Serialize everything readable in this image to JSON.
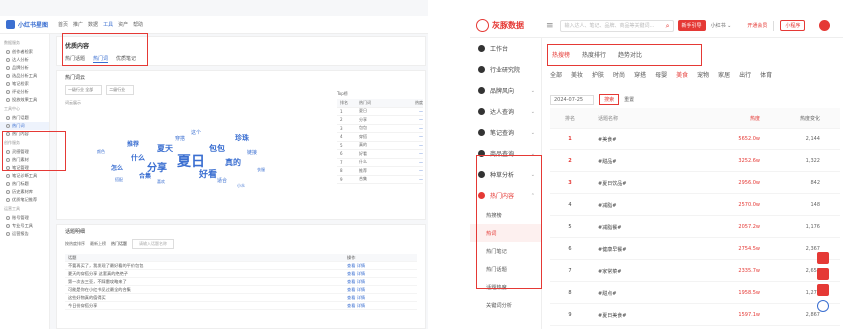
{
  "left": {
    "logo": "小红书星图",
    "nav": [
      "首页",
      "推广",
      "数据",
      "工具",
      "资产",
      "帮助"
    ],
    "sidebar": {
      "sections": [
        {
          "title": "数据服务",
          "items": [
            "创作者检索",
            "达人分析",
            "品牌分析",
            "选品分析工具",
            "笔记检索",
            "评论分析",
            "投放效果工具"
          ]
        },
        {
          "title": "工具中心",
          "items": [
            "热门话题",
            "热门词",
            "热门内容"
          ]
        },
        {
          "title": "创作服务",
          "items": [
            "灵感管理",
            "热门素材",
            "笔记管理",
            "笔记诊断工具",
            "热门标题",
            "历史素材库",
            "优质笔记推荐"
          ]
        },
        {
          "title": "运营工具",
          "items": [
            "账号管理",
            "专业号工具",
            "运营报告"
          ]
        }
      ],
      "active_item": "热门词"
    },
    "page_title": "优质内容",
    "tabs": [
      "热门话题",
      "热门词",
      "优质笔记"
    ],
    "active_tab": "热门词",
    "hot_words_header": "热门词云",
    "filter_1": "一级行业 全部",
    "filter_2": "二级行业",
    "cloud_label": "词云展示",
    "table_header": [
      "排名",
      "热门词",
      "热度"
    ],
    "table_title": "Top榜",
    "table_rows": [
      {
        "rank": "1",
        "word": "夏日"
      },
      {
        "rank": "2",
        "word": "分享"
      },
      {
        "rank": "3",
        "word": "包包"
      },
      {
        "rank": "4",
        "word": "穿搭"
      },
      {
        "rank": "5",
        "word": "真的"
      },
      {
        "rank": "6",
        "word": "好看"
      },
      {
        "rank": "7",
        "word": "什么"
      },
      {
        "rank": "8",
        "word": "推荐"
      },
      {
        "rank": "9",
        "word": "合集"
      }
    ],
    "cloud_words": [
      {
        "t": "夏日",
        "s": 14
      },
      {
        "t": "分享",
        "s": 10
      },
      {
        "t": "包包",
        "s": 8
      },
      {
        "t": "真的",
        "s": 8
      },
      {
        "t": "好看",
        "s": 9
      },
      {
        "t": "夏天",
        "s": 8
      },
      {
        "t": "珍珠",
        "s": 7
      },
      {
        "t": "什么",
        "s": 7
      },
      {
        "t": "推荐",
        "s": 6
      },
      {
        "t": "怎么",
        "s": 6
      },
      {
        "t": "合集",
        "s": 6
      },
      {
        "t": "穿搭",
        "s": 5
      },
      {
        "t": "这个",
        "s": 5
      },
      {
        "t": "链接",
        "s": 5
      },
      {
        "t": "搭配",
        "s": 4
      },
      {
        "t": "适合",
        "s": 5
      },
      {
        "t": "喜欢",
        "s": 4
      },
      {
        "t": "衣服",
        "s": 4
      },
      {
        "t": "颜色",
        "s": 4
      },
      {
        "t": "小众",
        "s": 4
      }
    ],
    "topic_section": "话题明细",
    "topic_tabs": [
      "按热度排序",
      "最新上榜",
      "热门话题"
    ],
    "topic_search": "请输入话题名称",
    "topic_cols": [
      "话题",
      "操作"
    ],
    "topic_rows": [
      {
        "t": "不要再买了，我发现了最好看的平价包包",
        "a": "查看  详情"
      },
      {
        "t": "夏天的穿搭分享 这套真的绝绝子",
        "a": "查看  详情"
      },
      {
        "t": "第一次去三亚，不踩雷攻略来了",
        "a": "查看  详情"
      },
      {
        "t": "可能是你在小红书见过最全的合集",
        "a": "查看  详情"
      },
      {
        "t": "这些好物真的值得买",
        "a": "查看  详情"
      },
      {
        "t": "今日份穿搭分享",
        "a": "查看  详情"
      }
    ]
  },
  "right": {
    "logo": "灰豚数据",
    "search_placeholder": "输入达人、笔记、品牌、商品等关键词...",
    "btn_primary": "新手引导",
    "select": "小红书",
    "vip": "开通会员",
    "mini": "小程序",
    "sidebar": [
      {
        "label": "工作台",
        "chev": ""
      },
      {
        "label": "行业研究院",
        "chev": ""
      },
      {
        "label": "品牌风向",
        "chev": "v"
      },
      {
        "label": "达人查询",
        "chev": "v"
      },
      {
        "label": "笔记查询",
        "chev": "v"
      },
      {
        "label": "商品查询",
        "chev": "v"
      },
      {
        "label": "种草分析",
        "chev": "v"
      },
      {
        "label": "热门内容",
        "chev": "^"
      }
    ],
    "submenu": [
      "热搜榜",
      "热词",
      "热门笔记",
      "热门话题",
      "话题热度",
      "关键词分析"
    ],
    "active_sub": "热词",
    "tabs": [
      "热搜榜",
      "热度排行",
      "趋势对比"
    ],
    "active_tab": "热搜榜",
    "categories": [
      "全部",
      "美妆",
      "护肤",
      "时尚",
      "穿搭",
      "母婴",
      "美食",
      "宠物",
      "家居",
      "出行",
      "体育"
    ],
    "active_cat": "美食",
    "date_filter": "2024-07-25",
    "btn_query": "搜索",
    "btn_reset": "重置",
    "cols": [
      "排名",
      "话题名称",
      "热度",
      "热度变化"
    ],
    "rows": [
      {
        "rank": "1",
        "topic": "#美食#",
        "hot": "5652.0w",
        "inc": "2,144"
      },
      {
        "rank": "2",
        "topic": "#甜品#",
        "hot": "3252.6w",
        "inc": "1,322"
      },
      {
        "rank": "3",
        "topic": "#夏日饮品#",
        "hot": "2956.0w",
        "inc": "842"
      },
      {
        "rank": "4",
        "topic": "#减脂#",
        "hot": "2570.0w",
        "inc": "148"
      },
      {
        "rank": "5",
        "topic": "#减脂餐#",
        "hot": "2057.2w",
        "inc": "1,176"
      },
      {
        "rank": "6",
        "topic": "#健康早餐#",
        "hot": "2754.5w",
        "inc": "2,367"
      },
      {
        "rank": "7",
        "topic": "#家常菜#",
        "hot": "2335.7w",
        "inc": "2,657"
      },
      {
        "rank": "8",
        "topic": "#甜点#",
        "hot": "1958.5w",
        "inc": "1,272"
      },
      {
        "rank": "9",
        "topic": "#夏日美食#",
        "hot": "1597.1w",
        "inc": "2,867"
      }
    ],
    "colors": {
      "accent": "#e53935",
      "blue": "#3b6fd1"
    }
  }
}
